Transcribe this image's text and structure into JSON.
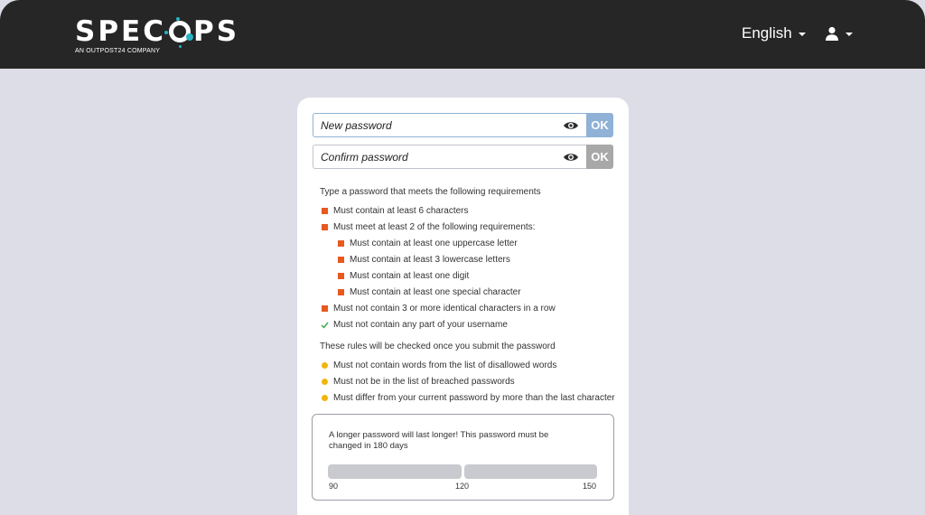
{
  "header": {
    "logo": "SPECOPS",
    "logo_tagline": "AN OUTPOST24 COMPANY",
    "language": "English"
  },
  "colors": {
    "topbar": "#262626",
    "background": "#dcdde6",
    "ok_new": "#8fb2d6",
    "ok_confirm": "#a8a8a8",
    "rule_failed": "#e8581f",
    "rule_passed": "#3aa54a",
    "rule_pending": "#f2b50c"
  },
  "form": {
    "new_password_placeholder": "New password",
    "confirm_password_placeholder": "Confirm password",
    "ok_label": "OK"
  },
  "requirements": {
    "intro": "Type a password that meets the following requirements",
    "items": [
      "Must contain at least 6 characters",
      "Must meet at least 2 of the following requirements:",
      "Must contain at least one uppercase letter",
      "Must contain at least 3 lowercase letters",
      "Must contain at least one digit",
      "Must contain at least one special character",
      "Must not contain 3 or more identical characters in a row",
      "Must not contain any part of your username"
    ],
    "statuses": [
      "failed",
      "failed",
      "failed",
      "failed",
      "failed",
      "failed",
      "failed",
      "passed"
    ]
  },
  "submit_rules": {
    "intro": "These rules will be checked once you submit the password",
    "items": [
      "Must not contain words from the list of disallowed words",
      "Must not be in the list of breached passwords",
      "Must differ from your current password by more than the last character"
    ]
  },
  "expiry": {
    "message": "A longer password will last longer! This password must be changed in 180 days",
    "ticks": [
      "90",
      "120",
      "150"
    ],
    "progress": 0
  }
}
